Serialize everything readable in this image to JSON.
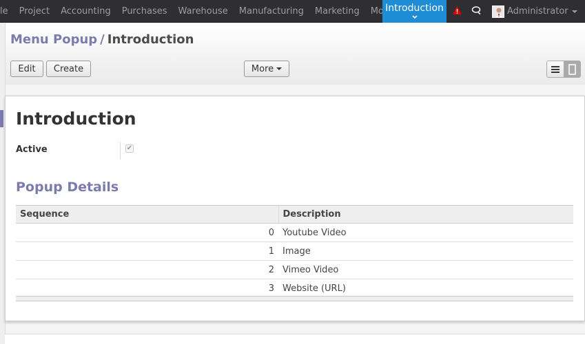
{
  "navbar": {
    "menu": [
      "le",
      "Project",
      "Accounting",
      "Purchases",
      "Warehouse",
      "Manufacturing",
      "Marketing",
      "More"
    ],
    "active_tab": "Introduction",
    "user": "Administrator"
  },
  "breadcrumb": {
    "parent": "Menu Popup",
    "separator": "/",
    "current": "Introduction"
  },
  "buttons": {
    "edit": "Edit",
    "create": "Create",
    "more": "More"
  },
  "form": {
    "title": "Introduction",
    "active_label": "Active",
    "active_checked": true,
    "section_title": "Popup Details"
  },
  "table": {
    "headers": [
      "Sequence",
      "Description"
    ],
    "rows": [
      {
        "sequence": "0",
        "description": "Youtube Video"
      },
      {
        "sequence": "1",
        "description": "Image"
      },
      {
        "sequence": "2",
        "description": "Vimeo Video"
      },
      {
        "sequence": "3",
        "description": "Website (URL)"
      }
    ]
  },
  "colors": {
    "navbar": "#2f2f33",
    "accent": "#7c7bad",
    "active_tab": "#1f8dd6",
    "warning": "#e00000"
  }
}
